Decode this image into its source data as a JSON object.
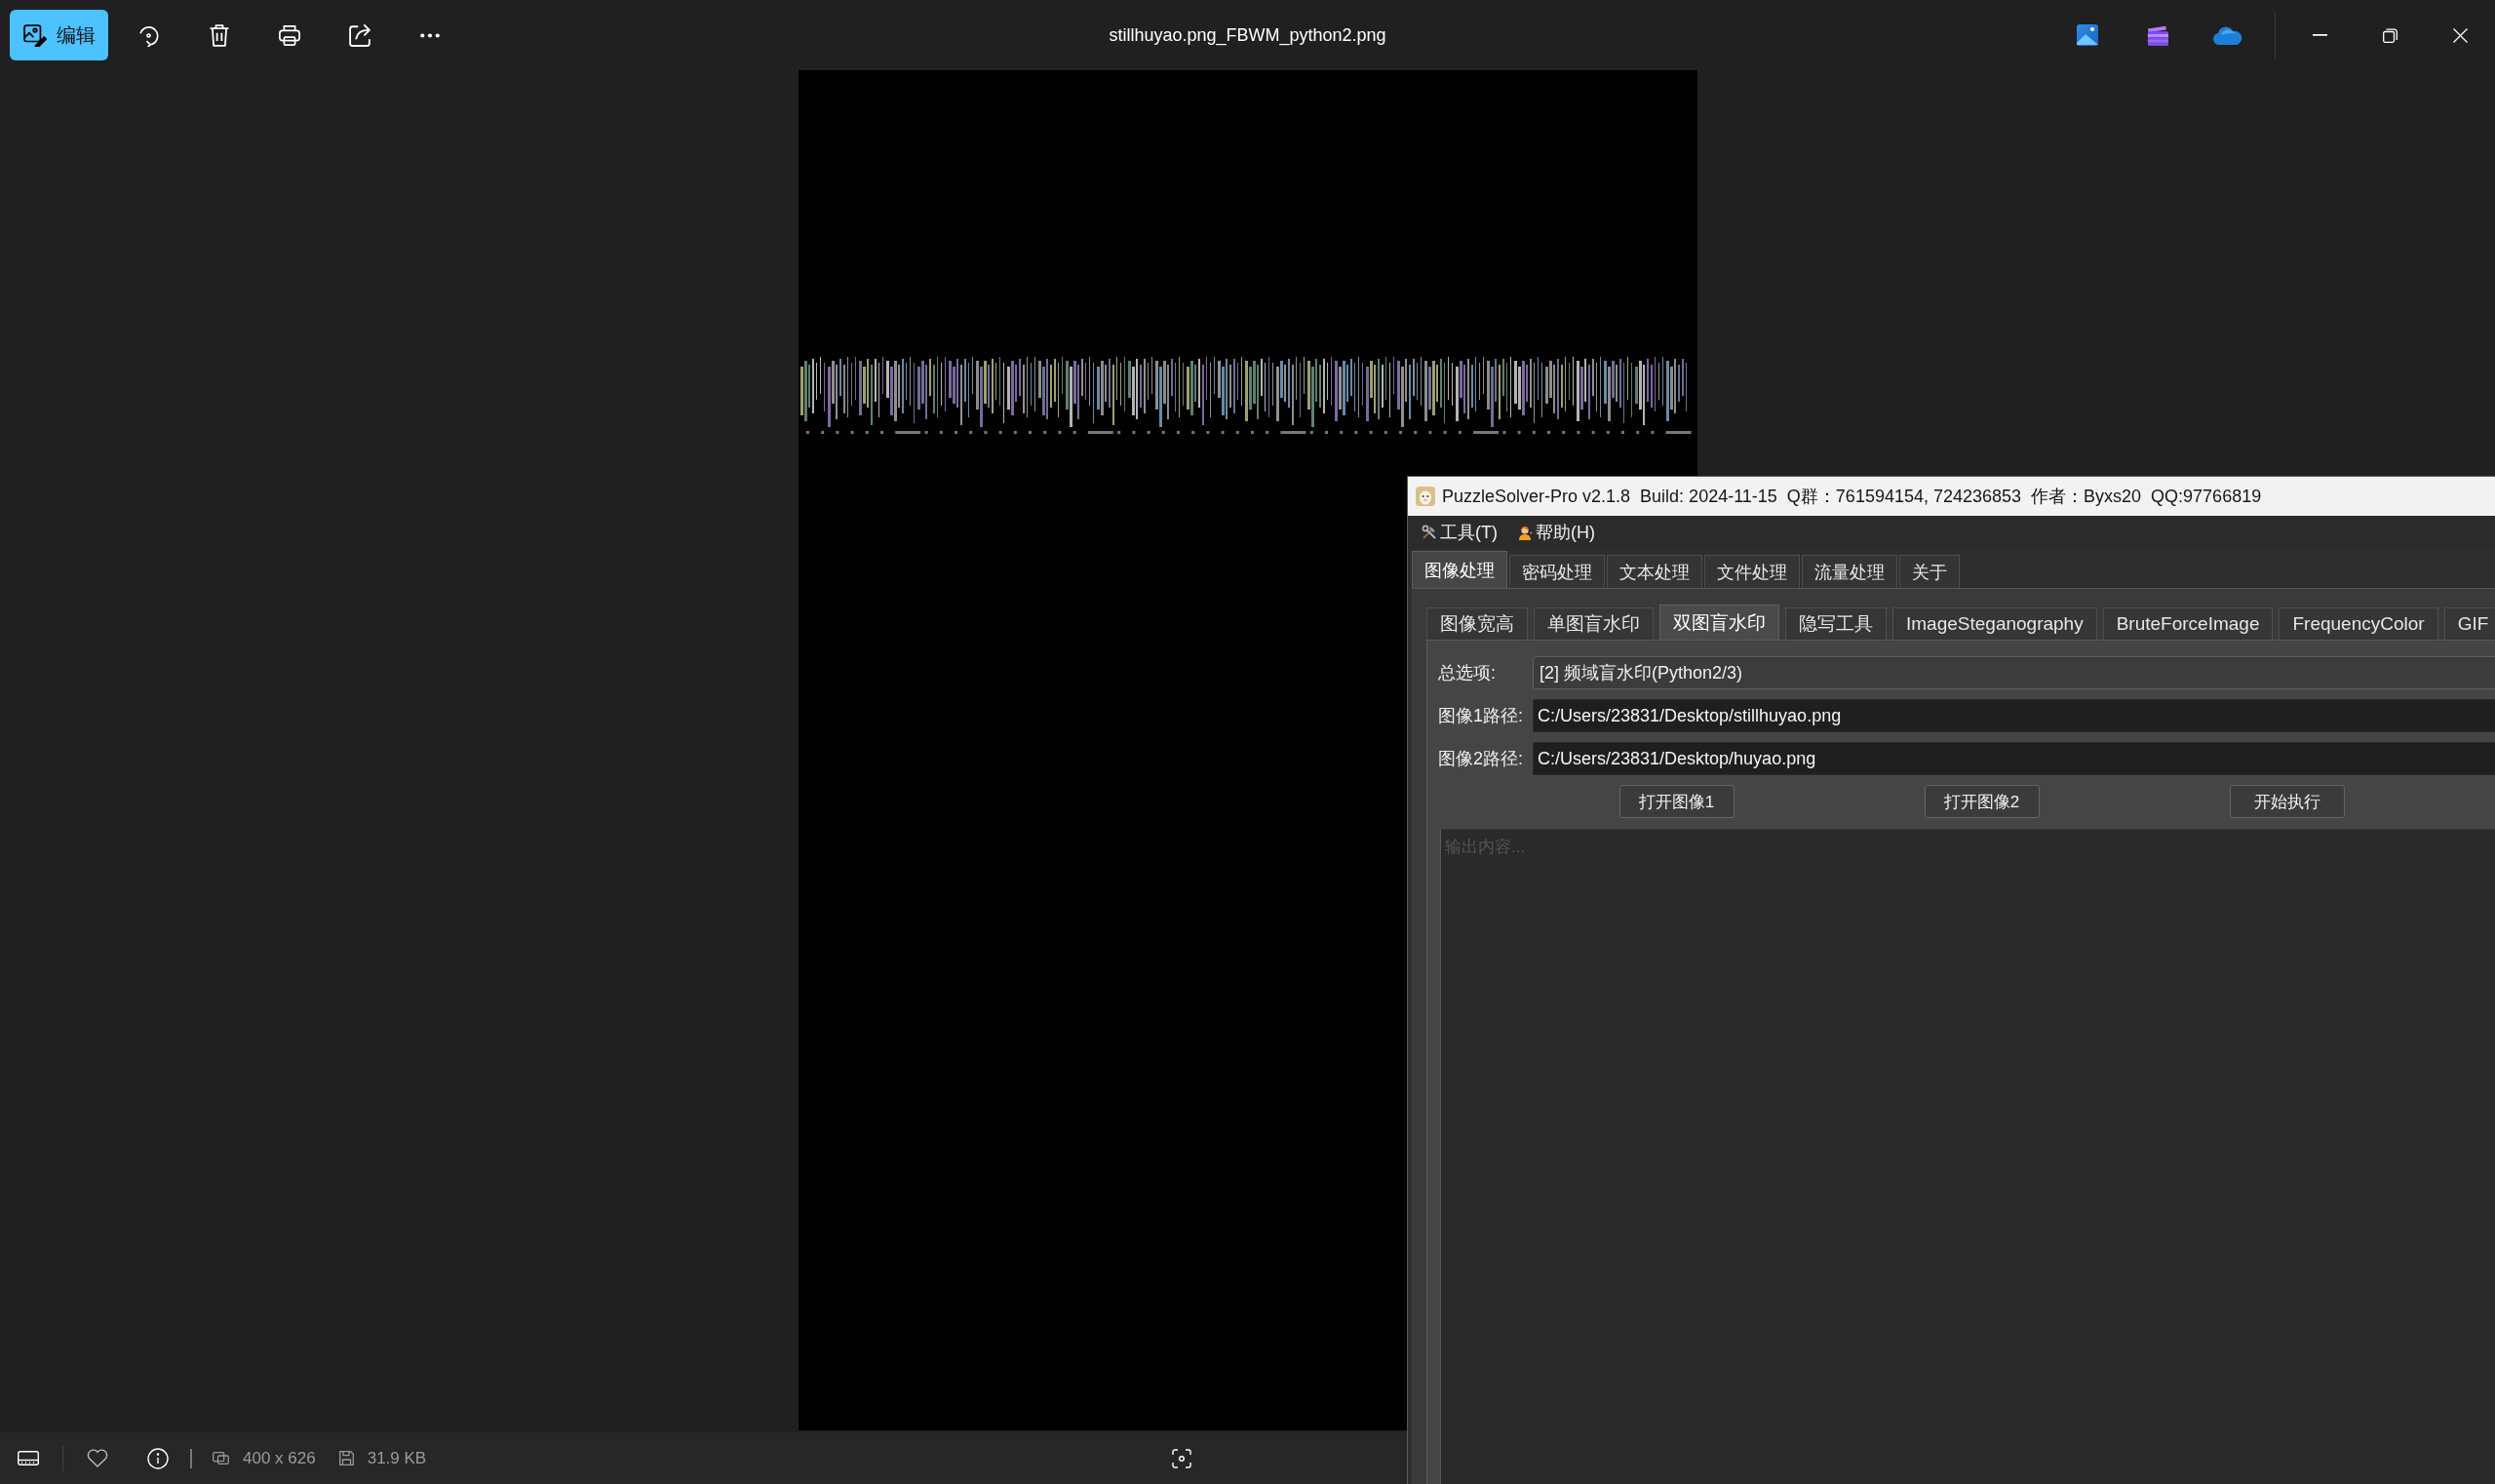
{
  "viewer": {
    "edit_button": "编辑",
    "title": "stillhuyao.png_FBWM_python2.png",
    "info_bar": {
      "dimensions": "400 x 626",
      "file_size": "31.9 KB"
    }
  },
  "solver": {
    "title": "PuzzleSolver-Pro v2.1.8  Build: 2024-11-15  Q群：761594154, 724236853  作者：Byxs20  QQ:97766819",
    "menu": [
      {
        "kind": "tools",
        "label": "工具(T)"
      },
      {
        "kind": "help",
        "label": "帮助(H)"
      }
    ],
    "tabs": [
      {
        "label": "图像处理",
        "selected": true
      },
      {
        "label": "密码处理",
        "selected": false
      },
      {
        "label": "文本处理",
        "selected": false
      },
      {
        "label": "文件处理",
        "selected": false
      },
      {
        "label": "流量处理",
        "selected": false
      },
      {
        "label": "关于",
        "selected": false
      }
    ],
    "sub_tabs": [
      {
        "label": "图像宽高",
        "selected": false
      },
      {
        "label": "单图盲水印",
        "selected": false
      },
      {
        "label": "双图盲水印",
        "selected": true
      },
      {
        "label": "隐写工具",
        "selected": false
      },
      {
        "label": "ImageSteganography",
        "selected": false
      },
      {
        "label": "BruteForceImage",
        "selected": false
      },
      {
        "label": "FrequencyColor",
        "selected": false
      },
      {
        "label": "GIF",
        "selected": false
      }
    ],
    "fields": [
      {
        "kind": "select",
        "label": "总选项:",
        "value": "[2] 频域盲水印(Python2/3)"
      },
      {
        "kind": "text",
        "label": "图像1路径:",
        "value": "C:/Users/23831/Desktop/stillhuyao.png"
      },
      {
        "kind": "text",
        "label": "图像2路径:",
        "value": "C:/Users/23831/Desktop/huyao.png"
      }
    ],
    "buttons": [
      "打开图像1",
      "打开图像2",
      "开始执行"
    ],
    "output": {
      "placeholder": "输出内容..."
    }
  }
}
